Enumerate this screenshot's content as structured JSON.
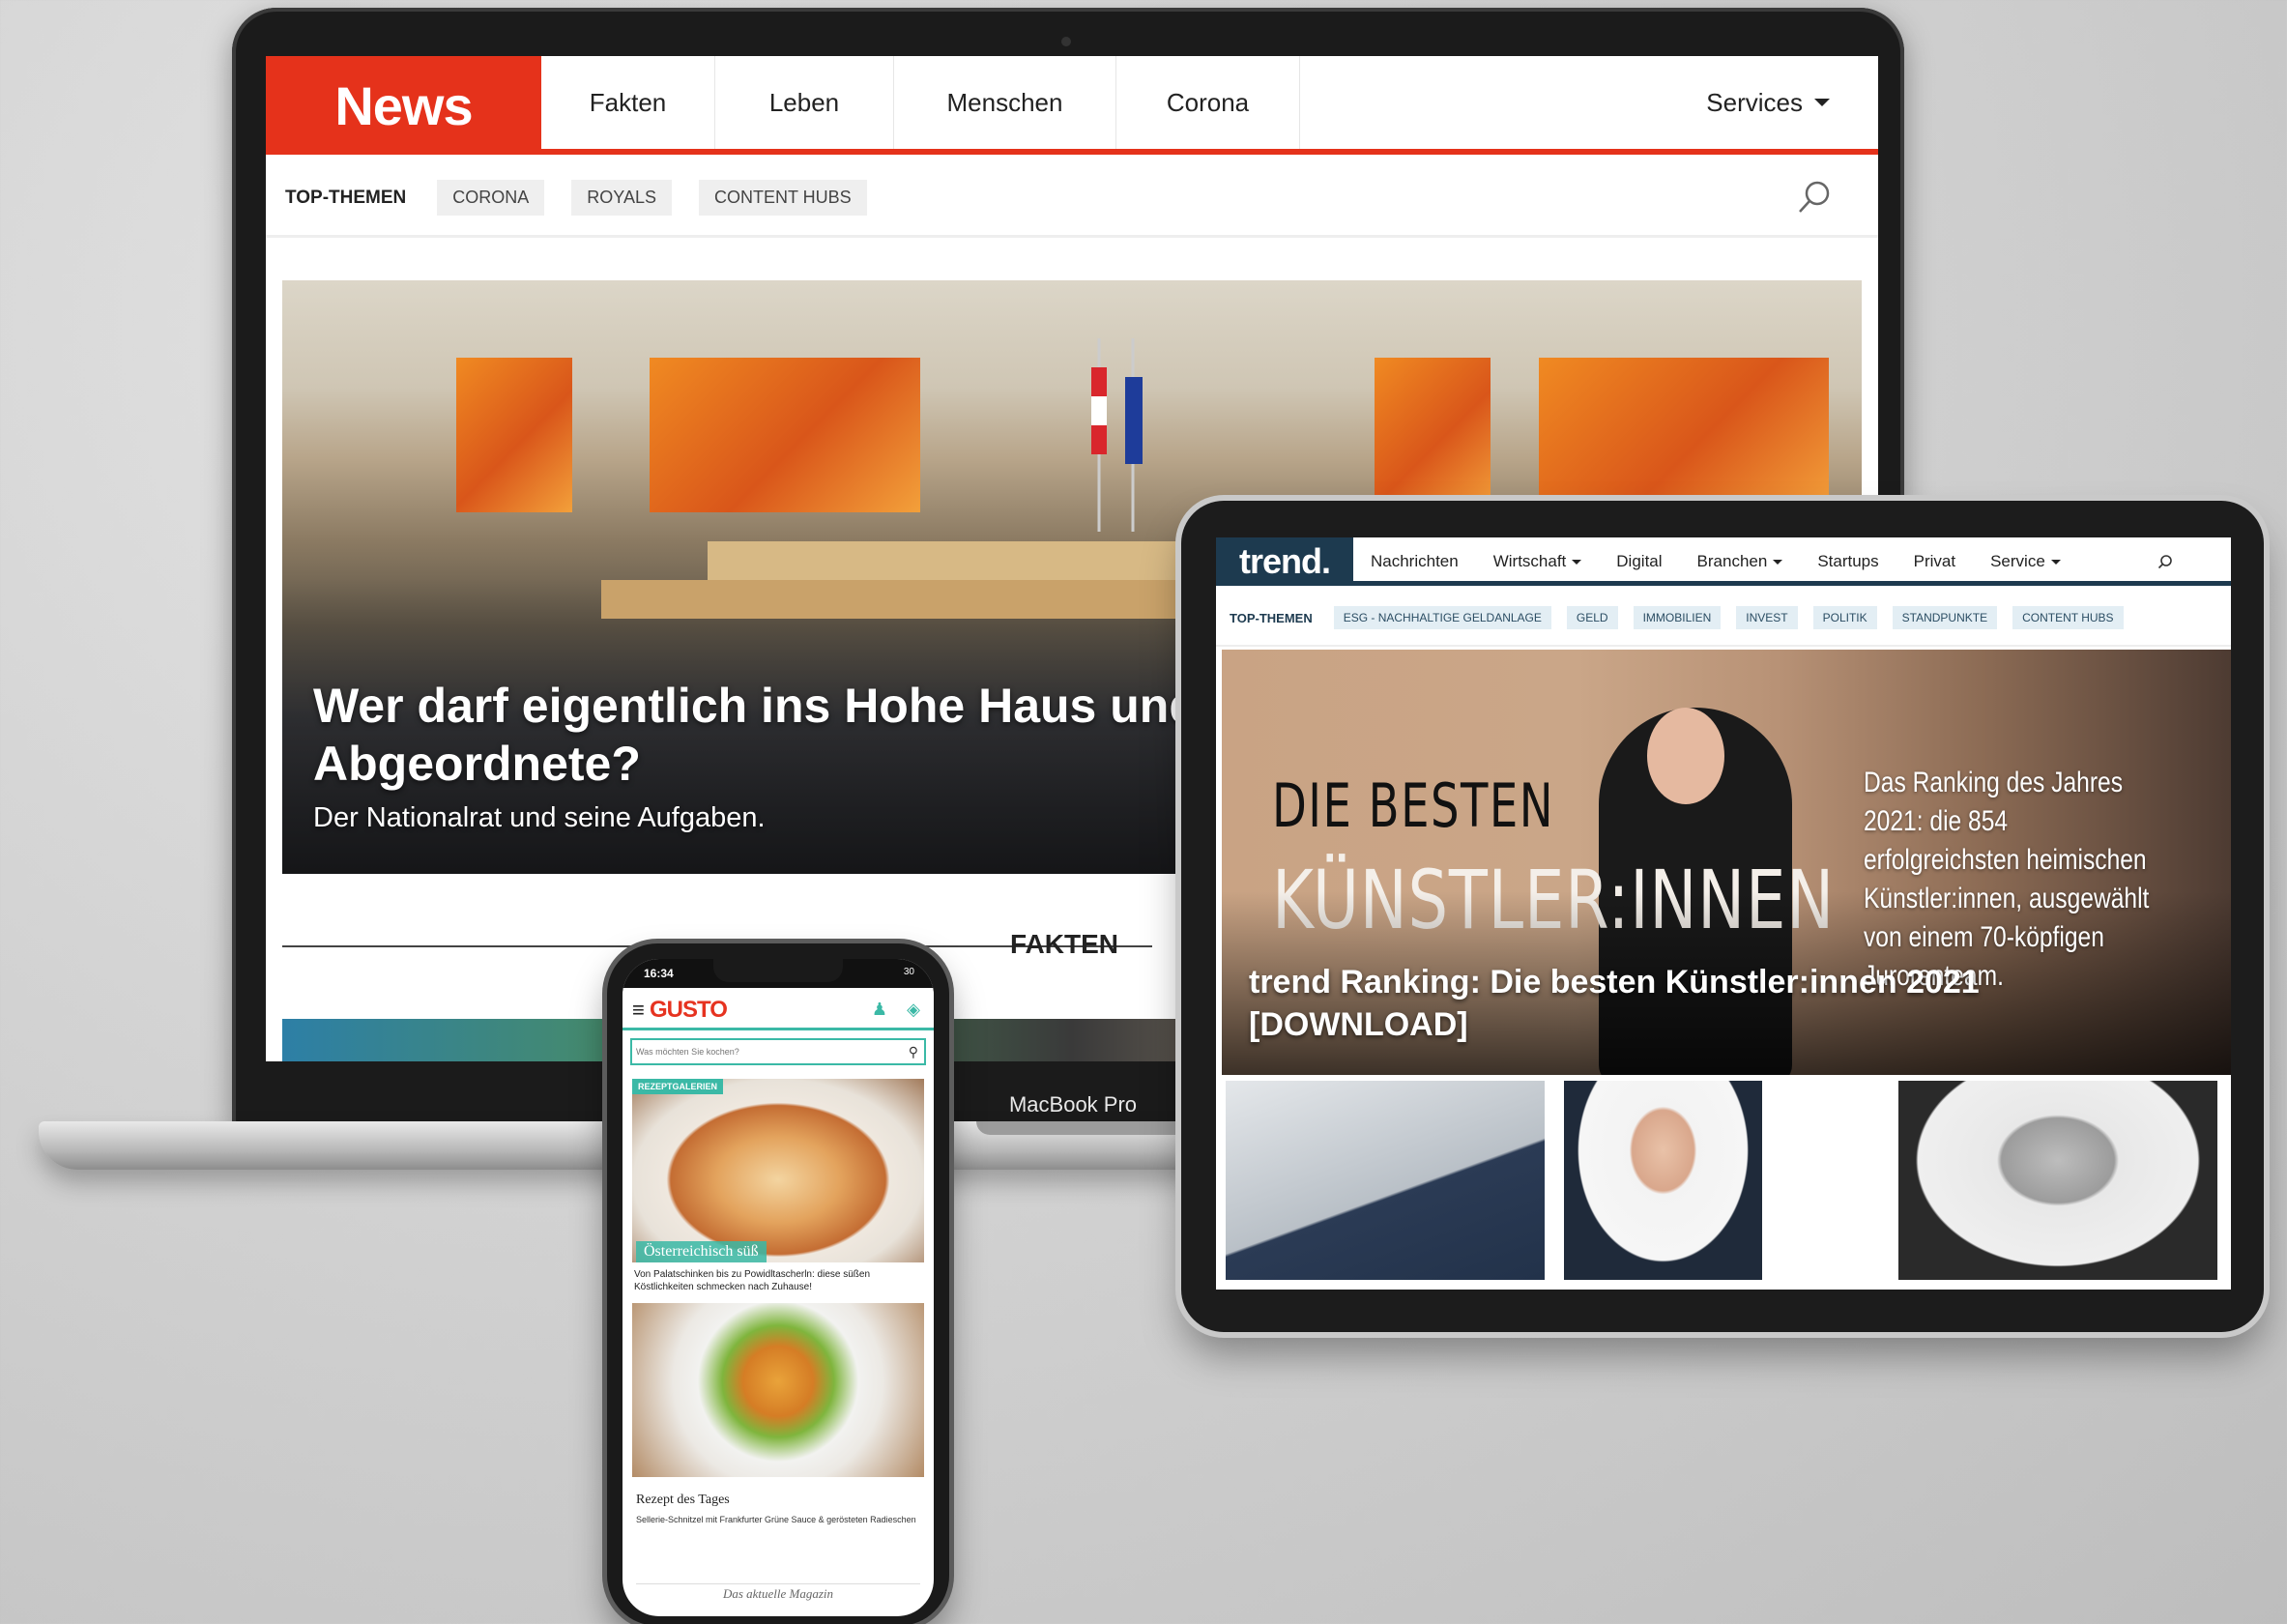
{
  "laptop": {
    "model_label": "MacBook Pro",
    "news": {
      "logo": "News",
      "nav": [
        "Fakten",
        "Leben",
        "Menschen",
        "Corona"
      ],
      "services": "Services",
      "topthemen_label": "TOP-THEMEN",
      "topthemen": [
        "CORONA",
        "ROYALS",
        "CONTENT HUBS"
      ],
      "hero_title": "Wer darf eigentlich ins Hohe Haus und Abgeordnete?",
      "hero_subtitle": "Der Nationalrat und seine Aufgaben.",
      "section_title": "FAKTEN"
    }
  },
  "tablet": {
    "trend": {
      "logo": "trend.",
      "nav": [
        "Nachrichten",
        "Wirtschaft",
        "Digital",
        "Branchen",
        "Startups",
        "Privat",
        "Service"
      ],
      "nav_dropdowns": [
        "Wirtschaft",
        "Branchen",
        "Service"
      ],
      "topthemen_label": "TOP-THEMEN",
      "topthemen": [
        "ESG - NACHHALTIGE GELDANLAGE",
        "GELD",
        "IMMOBILIEN",
        "INVEST",
        "POLITIK",
        "STANDPUNKTE",
        "CONTENT HUBS"
      ],
      "hero_big_1": "DIE BESTEN",
      "hero_big_2": "KÜNSTLER:INNEN",
      "hero_side_text": "Das Ranking des Jahres 2021: die 854 erfolgreichsten heimischen Künstler:innen, ausgewählt von einem 70-köpfigen Jurorenteam.",
      "hero_title": "trend Ranking: Die besten Künstler:innen 2021 [DOWNLOAD]"
    }
  },
  "phone": {
    "time": "16:34",
    "signal": "30",
    "gusto": {
      "logo": "GUSTO",
      "search_placeholder": "Was möchten Sie kochen?",
      "tag": "REZEPTGALERIEN",
      "card1_caption": "Österreichisch süß",
      "card1_text": "Von Palatschinken bis zu Powidltascherln: diese süßen Köstlichkeiten schmecken nach Zuhause!",
      "card2_label": "Rezept des Tages",
      "card2_text": "Sellerie-Schnitzel mit Frankfurter Grüne Sauce & gerösteten Radieschen",
      "footer": "Das aktuelle Magazin"
    }
  },
  "colors": {
    "news_red": "#e5321b",
    "trend_navy": "#1d3a4f",
    "gusto_teal": "#3bb9a6",
    "gusto_red": "#e63320"
  }
}
